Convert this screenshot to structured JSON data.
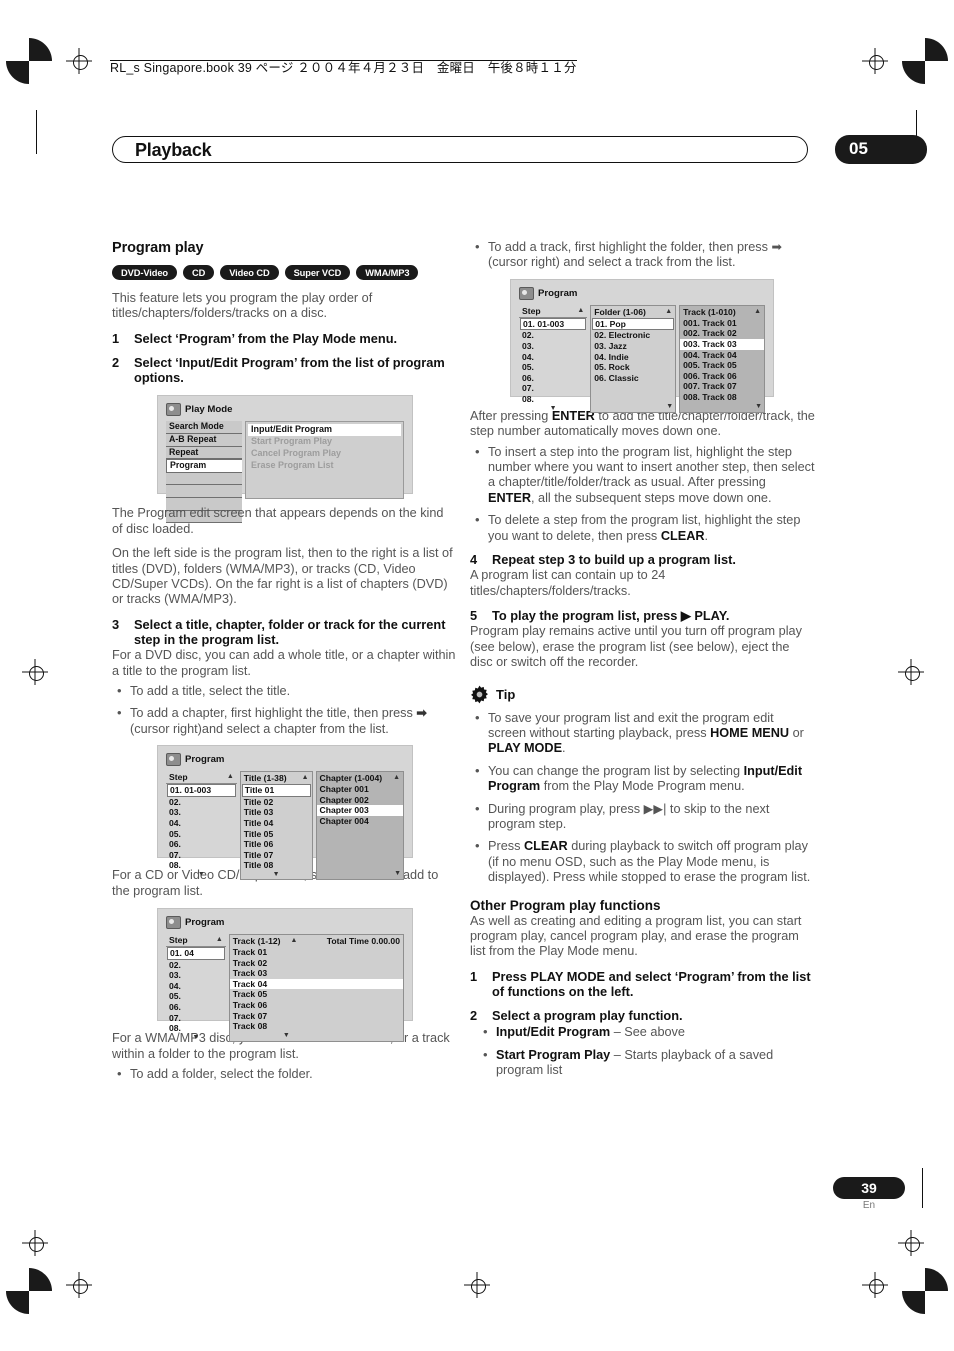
{
  "header": {
    "book_line": "RL_s Singapore.book  39 ページ  ２００４年４月２３日　金曜日　午後８時１１分"
  },
  "chapter": {
    "title": "Playback",
    "number": "05"
  },
  "footer": {
    "page_number": "39",
    "language": "En"
  },
  "left_column": {
    "section_title": "Program play",
    "badges": [
      {
        "label": "DVD-Video"
      },
      {
        "label": "CD"
      },
      {
        "label": "Video CD"
      },
      {
        "label": "Super VCD"
      },
      {
        "label": "WMA/MP3"
      }
    ],
    "intro": "This feature lets you program the play order of titles/chapters/folders/tracks on a disc.",
    "step1": {
      "number": "1",
      "text": "Select ‘Program’ from the Play Mode menu."
    },
    "step2": {
      "number": "2",
      "text": "Select ‘Input/Edit Program’ from the list of program options."
    },
    "after_playmode_1": "The Program edit screen that appears depends on the kind of disc loaded.",
    "after_playmode_2": "On the left side is the program list, then to the right is a list of titles (DVD), folders (WMA/MP3), or tracks (CD, Video CD/Super VCDs). On the far right is a list of chapters (DVD) or tracks (WMA/MP3).",
    "step3": {
      "number": "3",
      "text": "Select a title, chapter, folder or track for the current step in the program list."
    },
    "step3_body": "For a DVD disc, you can add a whole title, or a chapter within a title to the program list.",
    "step3_bullets": [
      "To add a title, select the title.",
      "To add a chapter, first highlight the title, then press ➡ (cursor right)and select a chapter from the list."
    ],
    "after_dvd_shot": "For a CD or Video CD/Super VCD, select a track to add to the program list.",
    "after_cd_shot": "For a WMA/MP3 disc, you can add a whole folder, or a track within a folder to the program list.",
    "wma_bullet": "To add a folder, select the folder."
  },
  "right_column": {
    "track_bullet": "To add a track, first highlight the folder, then press ➡ (cursor right) and select a track from the list.",
    "after_enter": "After pressing ENTER to add the title/chapter/folder/track, the step number automatically moves down one.",
    "enter_bullets": [
      "To insert a step into the program list, highlight the step number where you want to insert another step, then select a chapter/title/folder/track as usual. After pressing ENTER, all the subsequent steps move down one.",
      "To delete a step from the program list, highlight the step you want to delete, then press CLEAR."
    ],
    "step4": {
      "number": "4",
      "text": "Repeat step 3 to build up a program list."
    },
    "step4_body": "A program list can contain up to 24 titles/chapters/folders/tracks.",
    "step5": {
      "number": "5",
      "text": "To play the program list, press ▶ PLAY."
    },
    "step5_body": "Program play remains active until you turn off program play (see below), erase the program list (see below), eject the disc or switch off the recorder.",
    "tip_label": "Tip",
    "tip_bullets": [
      "To save your program list and exit the program edit screen without starting playback, press HOME MENU or PLAY MODE.",
      "You can change the program list by selecting Input/Edit Program from the Play Mode Program menu.",
      "During program play, press ▶▶| to skip to the next program step.",
      "Press CLEAR during playback to switch off program play (if no menu OSD, such as the Play Mode menu, is displayed). Press while stopped to erase the program list."
    ],
    "other_title": "Other Program play functions",
    "other_body": "As well as creating and editing a program list, you can start program play, cancel program play, and erase the program list from the Play Mode menu.",
    "other_step1": {
      "number": "1",
      "text": "Press PLAY MODE and select ‘Program’ from the list of functions on the left."
    },
    "other_step2": {
      "number": "2",
      "text": "Select a program play function."
    },
    "other_functions": [
      {
        "name": "Input/Edit Program",
        "desc": " – See above"
      },
      {
        "name": "Start Program Play",
        "desc": " – Starts playback of a saved program list"
      }
    ]
  },
  "osd_playmode": {
    "title": "Play Mode",
    "menu_items": [
      {
        "label": "Search Mode",
        "active": false
      },
      {
        "label": "A-B Repeat",
        "active": false
      },
      {
        "label": "Repeat",
        "active": false
      },
      {
        "label": "Program",
        "active": true
      }
    ],
    "options": [
      {
        "label": "Input/Edit Program",
        "highlighted": true
      },
      {
        "label": "Start Program Play",
        "highlighted": false
      },
      {
        "label": "Cancel Program Play",
        "highlighted": false
      },
      {
        "label": "Erase Program List",
        "highlighted": false
      }
    ]
  },
  "osd_dvd": {
    "title": "Program",
    "step_header": "Step",
    "steps": [
      "01. 01-003",
      "02.",
      "03.",
      "04.",
      "05.",
      "06.",
      "07.",
      "08."
    ],
    "middle_header": "Title (1-38)",
    "middle_items": [
      "Title 01",
      "Title 02",
      "Title 03",
      "Title 04",
      "Title 05",
      "Title 06",
      "Title 07",
      "Title 08"
    ],
    "middle_selected": 0,
    "right_header": "Chapter (1-004)",
    "right_items": [
      "Chapter 001",
      "Chapter 002",
      "Chapter 003",
      "Chapter 004"
    ],
    "right_selected": 2
  },
  "osd_cd": {
    "title": "Program",
    "step_header": "Step",
    "steps": [
      "01. 04",
      "02.",
      "03.",
      "04.",
      "05.",
      "06.",
      "07.",
      "08."
    ],
    "middle_header": "Track (1-12)",
    "total_time_label": "Total Time 0.00.00",
    "middle_items": [
      "Track 01",
      "Track 02",
      "Track 03",
      "Track 04",
      "Track 05",
      "Track 06",
      "Track 07",
      "Track 08"
    ],
    "middle_selected": 3
  },
  "osd_wma": {
    "title": "Program",
    "step_header": "Step",
    "steps": [
      "01. 01-003",
      "02.",
      "03.",
      "04.",
      "05.",
      "06.",
      "07.",
      "08."
    ],
    "middle_header": "Folder (1-06)",
    "middle_items": [
      "01. Pop",
      "02. Electronic",
      "03. Jazz",
      "04. Indie",
      "05. Rock",
      "06. Classic"
    ],
    "middle_selected": 0,
    "right_header": "Track (1-010)",
    "right_items": [
      "001. Track 01",
      "002. Track 02",
      "003. Track 03",
      "004. Track 04",
      "005. Track 05",
      "006. Track 06",
      "007. Track 07",
      "008. Track 08"
    ],
    "right_selected": 2
  }
}
